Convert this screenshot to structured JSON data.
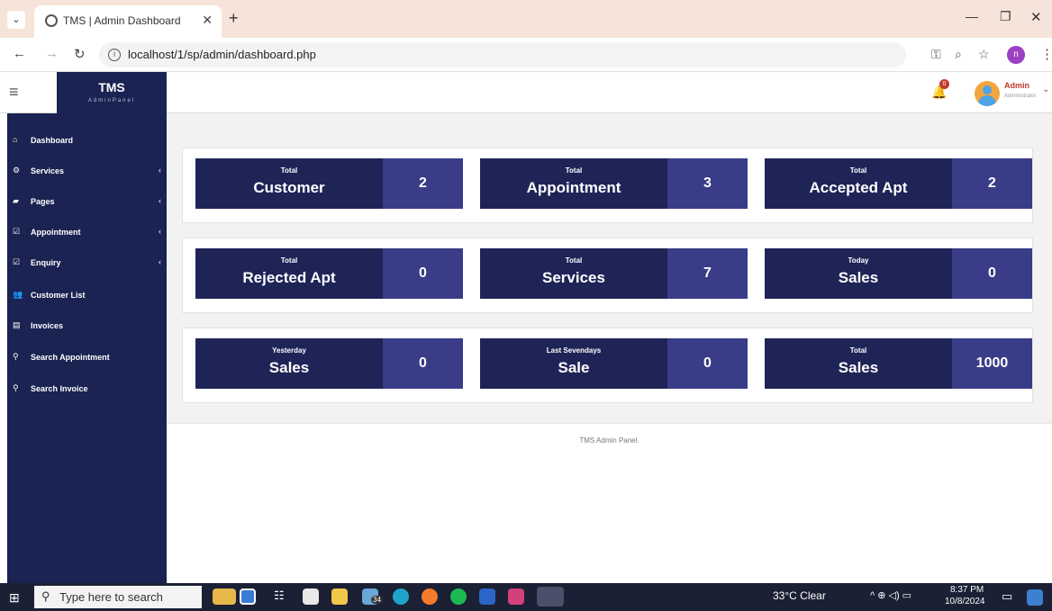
{
  "browser": {
    "tab_title": "TMS | Admin Dashboard",
    "url": "localhost/1/sp/admin/dashboard.php"
  },
  "header": {
    "brand_title": "TMS",
    "brand_subtitle": "AdminPanel",
    "notification_count": "0",
    "user_name": "Admin",
    "user_role": "Administrator"
  },
  "sidebar": {
    "items": [
      {
        "label": "Dashboard",
        "icon": "home-icon",
        "has_submenu": false
      },
      {
        "label": "Services",
        "icon": "cogs-icon",
        "has_submenu": true
      },
      {
        "label": "Pages",
        "icon": "book-icon",
        "has_submenu": true
      },
      {
        "label": "Appointment",
        "icon": "check-square-icon",
        "has_submenu": true
      },
      {
        "label": "Enquiry",
        "icon": "check-square-icon",
        "has_submenu": true
      },
      {
        "label": "Customer List",
        "icon": "users-icon",
        "has_submenu": false
      },
      {
        "label": "Invoices",
        "icon": "file-icon",
        "has_submenu": false
      },
      {
        "label": "Search Appointment",
        "icon": "search-icon",
        "has_submenu": false
      },
      {
        "label": "Search Invoice",
        "icon": "search-icon",
        "has_submenu": false
      }
    ]
  },
  "stats": {
    "rows": [
      [
        {
          "small": "Total",
          "big": "Customer",
          "value": "2"
        },
        {
          "small": "Total",
          "big": "Appointment",
          "value": "3"
        },
        {
          "small": "Total",
          "big": "Accepted Apt",
          "value": "2"
        }
      ],
      [
        {
          "small": "Total",
          "big": "Rejected Apt",
          "value": "0"
        },
        {
          "small": "Total",
          "big": "Services",
          "value": "7"
        },
        {
          "small": "Today",
          "big": "Sales",
          "value": "0"
        }
      ],
      [
        {
          "small": "Yesterday",
          "big": "Sales",
          "value": "0"
        },
        {
          "small": "Last Sevendays",
          "big": "Sale",
          "value": "0"
        },
        {
          "small": "Total",
          "big": "Sales",
          "value": "1000"
        }
      ]
    ]
  },
  "footer": {
    "text": "TMS Admin Panel."
  },
  "taskbar": {
    "search_placeholder": "Type here to search",
    "mail_badge": "34",
    "weather": "33°C  Clear",
    "time": "8:37 PM",
    "date": "10/8/2024",
    "notification_count": "1"
  },
  "colors": {
    "sidebar_bg": "#1b2352",
    "card_dark": "#1f2457",
    "card_light": "#393c87",
    "content_bg": "#f2f2f2",
    "tabstrip_bg": "#f6e4da"
  }
}
